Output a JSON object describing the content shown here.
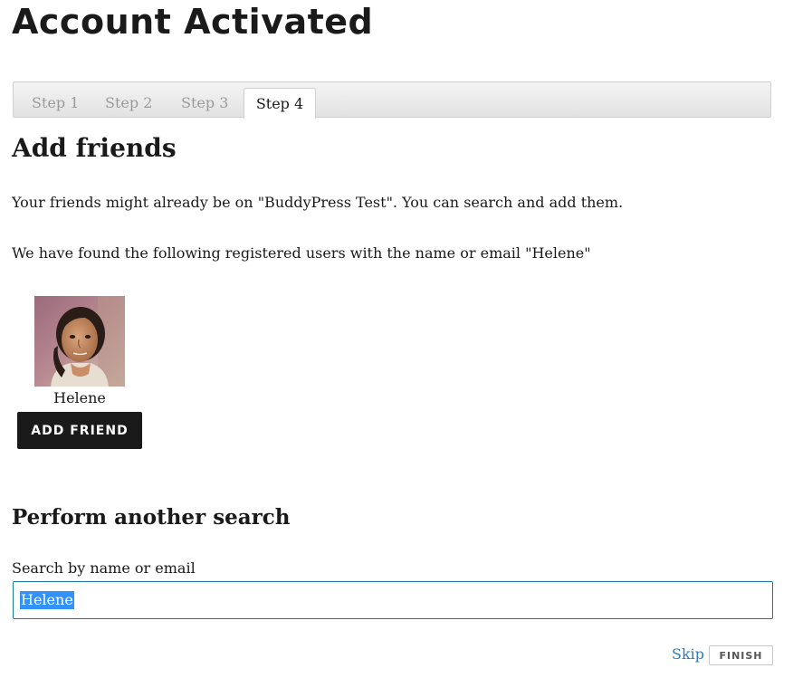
{
  "page": {
    "title": "Account Activated"
  },
  "steps": {
    "items": [
      {
        "label": "Step 1",
        "active": false
      },
      {
        "label": "Step 2",
        "active": false
      },
      {
        "label": "Step 3",
        "active": false
      },
      {
        "label": "Step 4",
        "active": true
      }
    ]
  },
  "add_friends": {
    "heading": "Add friends",
    "intro": "Your friends might already be on \"BuddyPress Test\". You can search and add them.",
    "results_text": "We have found the following registered users with the name or email \"Helene\""
  },
  "results": [
    {
      "name": "Helene",
      "avatar_icon": "user-avatar-photo",
      "button_label": "ADD FRIEND"
    }
  ],
  "search": {
    "heading": "Perform another search",
    "label": "Search by name or email",
    "value": "Helene"
  },
  "actions": {
    "skip_label": "Skip",
    "finish_label": "FINISH"
  },
  "colors": {
    "button_dark": "#1a1a1a",
    "link": "#2f79b8",
    "input_border": "#1a7a9c",
    "selection": "#3390ff"
  }
}
